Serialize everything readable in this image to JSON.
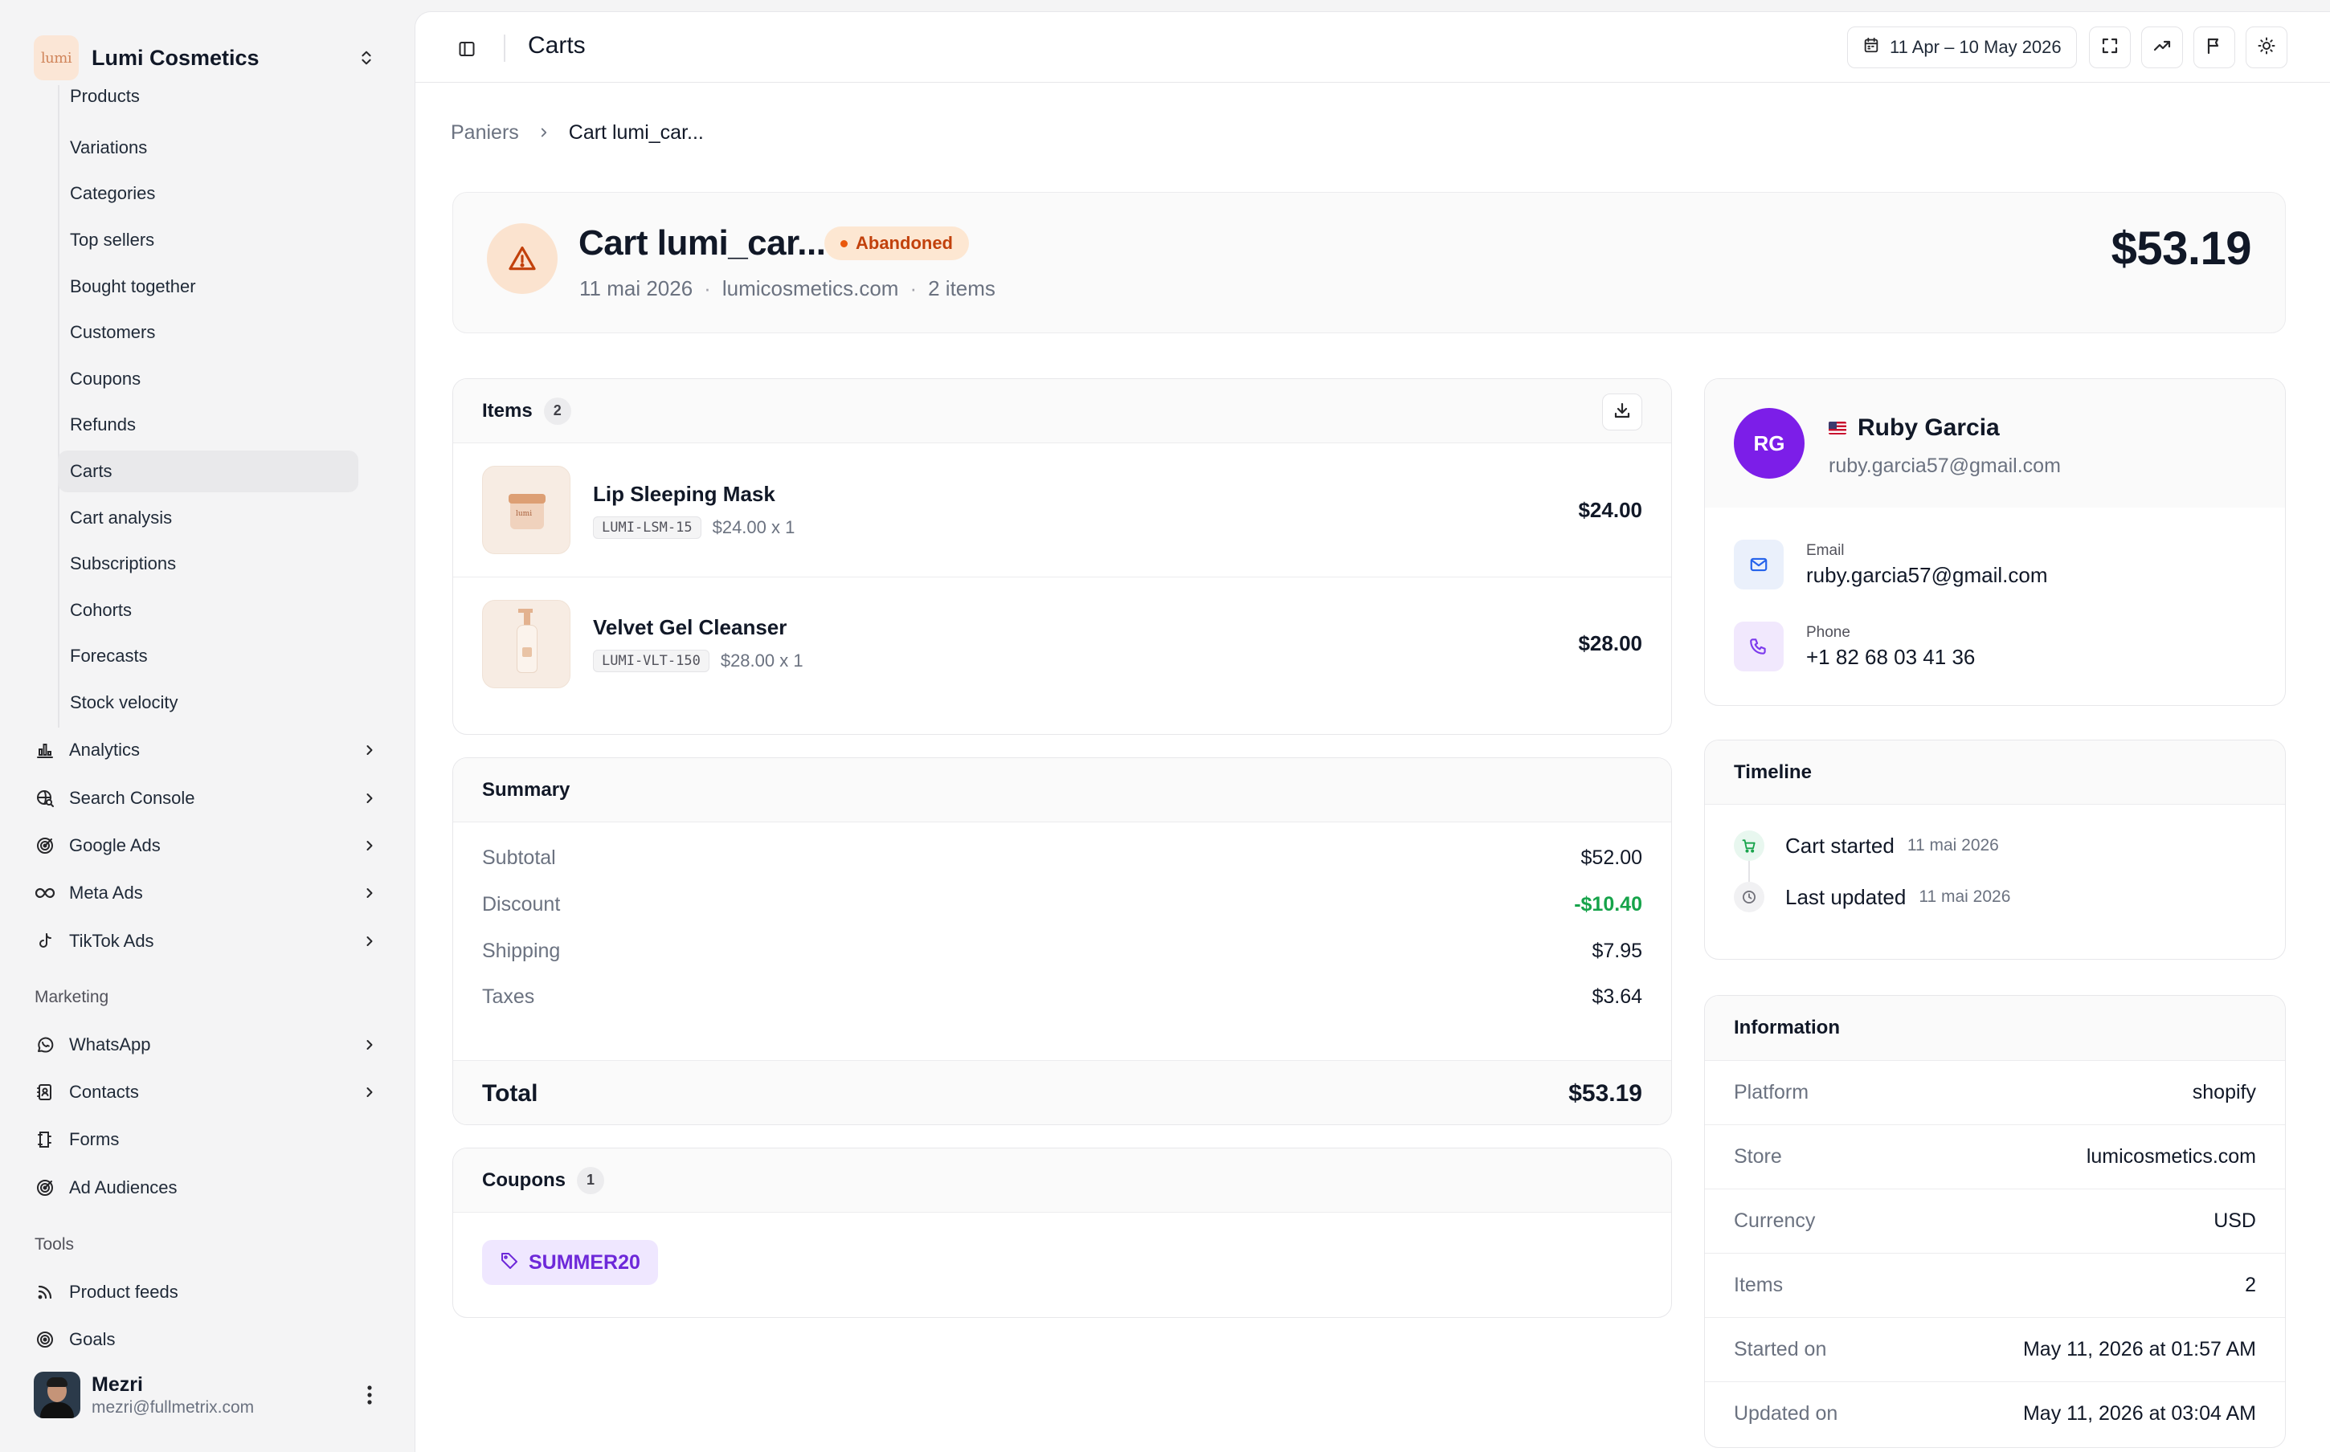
{
  "app": {
    "brand_logo_text": "lumi",
    "brand_name": "Lumi Cosmetics"
  },
  "sidebar": {
    "sub_items": [
      {
        "label": "Products"
      },
      {
        "label": "Variations"
      },
      {
        "label": "Categories"
      },
      {
        "label": "Top sellers"
      },
      {
        "label": "Bought together"
      },
      {
        "label": "Customers"
      },
      {
        "label": "Coupons"
      },
      {
        "label": "Refunds"
      },
      {
        "label": "Carts",
        "active": true
      },
      {
        "label": "Cart analysis"
      },
      {
        "label": "Subscriptions"
      },
      {
        "label": "Cohorts"
      },
      {
        "label": "Forecasts"
      },
      {
        "label": "Stock velocity"
      }
    ],
    "groups": [
      {
        "label": "Analytics",
        "icon": "bar-chart-icon"
      },
      {
        "label": "Search Console",
        "icon": "globe-search-icon"
      },
      {
        "label": "Google Ads",
        "icon": "target-icon"
      },
      {
        "label": "Meta Ads",
        "icon": "infinity-icon"
      },
      {
        "label": "TikTok Ads",
        "icon": "tiktok-icon"
      }
    ],
    "marketing_title": "Marketing",
    "marketing": [
      {
        "label": "WhatsApp",
        "icon": "whatsapp-icon"
      },
      {
        "label": "Contacts",
        "icon": "contacts-book-icon"
      },
      {
        "label": "Forms",
        "icon": "form-icon"
      },
      {
        "label": "Ad Audiences",
        "icon": "audience-target-icon"
      }
    ],
    "tools_title": "Tools",
    "tools": [
      {
        "label": "Product feeds",
        "icon": "rss-icon"
      },
      {
        "label": "Goals",
        "icon": "goal-icon"
      }
    ],
    "user": {
      "name": "Mezri",
      "email": "mezri@fullmetrix.com"
    }
  },
  "topbar": {
    "title": "Carts",
    "date_range": "11 Apr – 10 May 2026"
  },
  "breadcrumb": {
    "root": "Paniers",
    "current": "Cart lumi_car..."
  },
  "cart": {
    "title": "Cart lumi_car...",
    "status": "Abandoned",
    "date": "11 mai 2026",
    "store": "lumicosmetics.com",
    "items_count_text": "2 items",
    "total": "$53.19"
  },
  "items_card": {
    "title": "Items",
    "count": "2",
    "items": [
      {
        "name": "Lip Sleeping Mask",
        "sku": "LUMI-LSM-15",
        "qty": "$24.00 x 1",
        "price": "$24.00"
      },
      {
        "name": "Velvet Gel Cleanser",
        "sku": "LUMI-VLT-150",
        "qty": "$28.00 x 1",
        "price": "$28.00"
      }
    ]
  },
  "summary": {
    "title": "Summary",
    "rows": [
      {
        "label": "Subtotal",
        "value": "$52.00"
      },
      {
        "label": "Discount",
        "value": "-$10.40"
      },
      {
        "label": "Shipping",
        "value": "$7.95"
      },
      {
        "label": "Taxes",
        "value": "$3.64"
      }
    ],
    "total_label": "Total",
    "total_value": "$53.19"
  },
  "coupons": {
    "title": "Coupons",
    "count": "1",
    "code": "SUMMER20"
  },
  "customer": {
    "initials": "RG",
    "name": "Ruby Garcia",
    "email": "ruby.garcia57@gmail.com",
    "email_label": "Email",
    "email_value": "ruby.garcia57@gmail.com",
    "phone_label": "Phone",
    "phone_value": "+1 82 68 03 41 36"
  },
  "timeline": {
    "title": "Timeline",
    "events": [
      {
        "label": "Cart started",
        "date": "11 mai 2026"
      },
      {
        "label": "Last updated",
        "date": "11 mai 2026"
      }
    ]
  },
  "information": {
    "title": "Information",
    "rows": [
      {
        "label": "Platform",
        "value": "shopify"
      },
      {
        "label": "Store",
        "value": "lumicosmetics.com"
      },
      {
        "label": "Currency",
        "value": "USD"
      },
      {
        "label": "Items",
        "value": "2"
      },
      {
        "label": "Started on",
        "value": "May 11, 2026 at 01:57 AM"
      },
      {
        "label": "Updated on",
        "value": "May 11, 2026 at 03:04 AM"
      }
    ]
  },
  "colors": {
    "accent_purple": "#7c1ee8",
    "status_orange": "#c2410c",
    "discount_green": "#16a34a"
  }
}
